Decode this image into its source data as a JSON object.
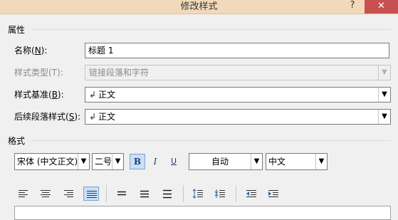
{
  "window": {
    "title": "修改样式",
    "help_label": "?",
    "close_label": "✕"
  },
  "properties": {
    "section_label": "属性",
    "name_label_pre": "名称(",
    "name_label_key": "N",
    "name_label_post": "):",
    "name_value": "标题 1",
    "style_type_label": "样式类型(T):",
    "style_type_value": "链接段落和字符",
    "based_on_label_pre": "样式基准(",
    "based_on_label_key": "B",
    "based_on_label_post": "):",
    "based_on_value": "正文",
    "following_label_pre": "后续段落样式(",
    "following_label_key": "S",
    "following_label_post": "):",
    "following_value": "正文"
  },
  "format": {
    "section_label": "格式",
    "font_value": "宋体 (中文正文)",
    "size_value": "二号",
    "bold_label": "B",
    "italic_label": "I",
    "underline_label": "U",
    "color_value": "自动",
    "language_value": "中文",
    "bold_active": true
  },
  "icons": {
    "return_glyph": "↲",
    "dropdown_glyph": "▼"
  }
}
